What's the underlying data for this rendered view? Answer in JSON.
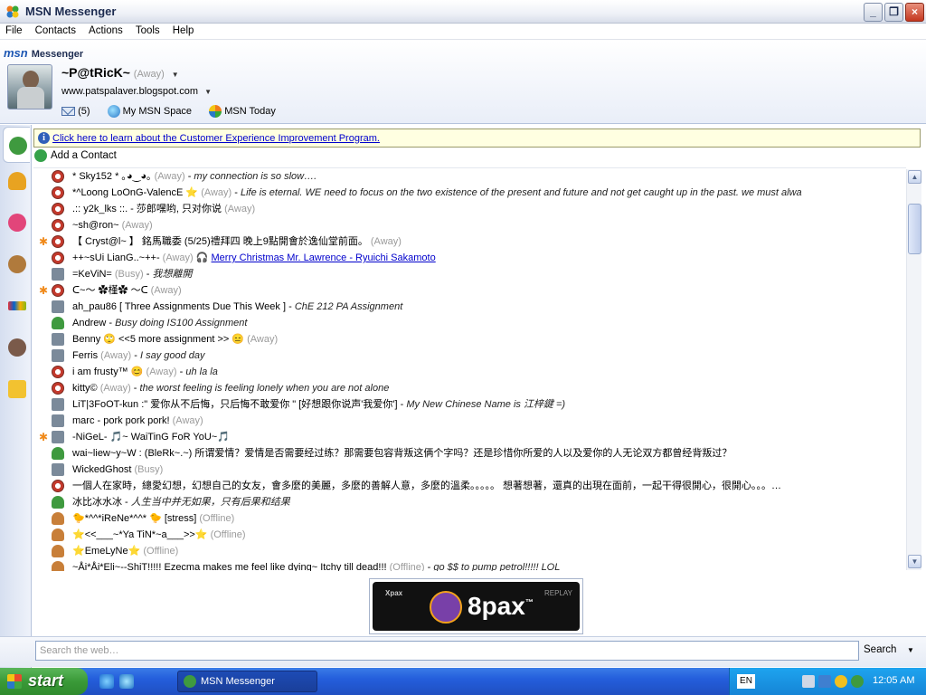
{
  "window": {
    "title": "MSN Messenger",
    "controls": [
      "_",
      "❐",
      "×"
    ]
  },
  "menu": [
    "File",
    "Contacts",
    "Actions",
    "Tools",
    "Help"
  ],
  "header": {
    "logo": "msn",
    "logo_sub": "Messenger",
    "username": "~P@tRicK~",
    "status": "(Away)",
    "personal_message": "www.patspalaver.blogspot.com",
    "mail_count": "(5)",
    "space_link": "My MSN Space",
    "today_link": "MSN Today"
  },
  "infobar": {
    "text": "Click here to learn about the Customer Experience Improvement Program."
  },
  "add_contact": "Add a Contact",
  "contacts": [
    {
      "star": false,
      "icon": "away",
      "name": "* Sky152 * ｡◕‿◕｡ ",
      "status": "(Away)",
      "sep": " - ",
      "message": "my connection is so slow….",
      "link": ""
    },
    {
      "star": false,
      "icon": "away",
      "name": "*^Loong LoOnG-ValencE ⭐ ",
      "status": "(Away)",
      "sep": " - ",
      "message": "Life is eternal. WE need to focus on the two existence of the present and future and not get caught  up in the past. we must alwa",
      "link": ""
    },
    {
      "star": false,
      "icon": "away",
      "name": ".:: y2k_lks ::. - 莎郎嘿哟, 只对你说 ",
      "status": "(Away)",
      "sep": "",
      "message": "",
      "link": ""
    },
    {
      "star": false,
      "icon": "away",
      "name": "~sh@ron~ ",
      "status": "(Away)",
      "sep": "",
      "message": "",
      "link": ""
    },
    {
      "star": true,
      "icon": "away",
      "name": "【 Cryst@l~ 】 銘馬職委 (5/25)禮拜四  晚上9點開會於逸仙堂前面。 ",
      "status": "(Away)",
      "sep": "",
      "message": "",
      "link": ""
    },
    {
      "star": false,
      "icon": "away",
      "name": "++~sUi LianG..~++- ",
      "status": "(Away)",
      "sep": " 🎧 ",
      "message": "",
      "link": "Merry Christmas Mr. Lawrence - Ryuichi Sakamoto"
    },
    {
      "star": false,
      "icon": "busy",
      "name": "=KeViN= ",
      "status": "(Busy)",
      "sep": " - ",
      "message": "我想離開",
      "link": ""
    },
    {
      "star": true,
      "icon": "away",
      "name": "ᑕ~〜    ✿槿✿    〜ᑕ ",
      "status": "(Away)",
      "sep": "",
      "message": "",
      "link": ""
    },
    {
      "star": false,
      "icon": "busy",
      "name": "ah_pau86 [ Three Assignments Due This Week ]",
      "status": "",
      "sep": " - ",
      "message": "ChE 212 PA Assignment",
      "link": ""
    },
    {
      "star": false,
      "icon": "online",
      "name": "Andrew",
      "status": "",
      "sep": " - ",
      "message": "Busy doing IS100 Assignment",
      "link": ""
    },
    {
      "star": false,
      "icon": "busy",
      "name": "Benny 🙄 <<5 more assignment >> 😑 ",
      "status": "(Away)",
      "sep": "",
      "message": "",
      "link": ""
    },
    {
      "star": false,
      "icon": "busy",
      "name": "Ferris ",
      "status": "(Away)",
      "sep": " - ",
      "message": "I say good day",
      "link": ""
    },
    {
      "star": false,
      "icon": "away",
      "name": "i am frusty™ 😊 ",
      "status": "(Away)",
      "sep": " - ",
      "message": "uh la la",
      "link": ""
    },
    {
      "star": false,
      "icon": "away",
      "name": "kitty© ",
      "status": "(Away)",
      "sep": " - ",
      "message": "the worst feeling is feeling lonely when you are not alone",
      "link": ""
    },
    {
      "star": false,
      "icon": "busy",
      "name": "LiT|3FoOT-kun :\" 爱你从不后悔，只后悔不敢爱你 \" [好想跟你说声'我爱你']",
      "status": "",
      "sep": " - ",
      "message": "My New Chinese Name is 江梓鍵 =)",
      "link": ""
    },
    {
      "star": false,
      "icon": "busy",
      "name": "marc - pork pork pork! ",
      "status": "(Away)",
      "sep": "",
      "message": "",
      "link": ""
    },
    {
      "star": true,
      "icon": "busy",
      "name": "-NiGeL- 🎵~ WaiTinG FoR YoU~🎵",
      "status": "",
      "sep": "",
      "message": "",
      "link": ""
    },
    {
      "star": false,
      "icon": "online",
      "name": "wai~liew~y~W : (BleRk~.~) 所谓爱情？爱情是否需要经过练？那需要包容背叛这俩个字吗？还是珍惜你所爱的人以及爱你的人无论双方都曾经背叛过？",
      "status": "",
      "sep": "",
      "message": "",
      "link": ""
    },
    {
      "star": false,
      "icon": "busy",
      "name": "WickedGhost ",
      "status": "(Busy)",
      "sep": "",
      "message": "",
      "link": ""
    },
    {
      "star": false,
      "icon": "away",
      "name": "一個人在家時，總愛幻想，幻想自己的女友，會多麼的美麗，多麼的善解人意，多麼的溫柔。。。。。  想著想著，還真的出現在面前，一起干得很開心，很開心。。。…",
      "status": "",
      "sep": "",
      "message": "",
      "link": ""
    },
    {
      "star": false,
      "icon": "online",
      "name": "冰比冰水冰",
      "status": "",
      "sep": " - ",
      "message": "人生当中并无如果，只有后果和结果",
      "link": ""
    },
    {
      "star": false,
      "icon": "offline",
      "name": "🐤*^^*iReNe*^^* 🐤 [stress] ",
      "status": "(Offline)",
      "sep": "",
      "message": "",
      "link": ""
    },
    {
      "star": false,
      "icon": "offline",
      "name": "⭐<<___~*Ya TiN*~a___>>⭐ ",
      "status": "(Offline)",
      "sep": "",
      "message": "",
      "link": ""
    },
    {
      "star": false,
      "icon": "offline",
      "name": "⭐EmeLyNe⭐ ",
      "status": "(Offline)",
      "sep": "",
      "message": "",
      "link": ""
    },
    {
      "star": false,
      "icon": "offline",
      "name": "~Åi*Åi*Elі~--ShiT!!!!! Ezecma makes me feel like dying~ Itchy till dead!!! ",
      "status": "(Offline)",
      "sep": " - ",
      "message": "go $$ to pump petrol!!!!! LOL",
      "link": ""
    }
  ],
  "ad": {
    "small": "Xpax",
    "brand": "8pax",
    "tm": "™",
    "replay": "REPLAY"
  },
  "search": {
    "placeholder": "Search the web…",
    "button": "Search"
  },
  "taskbar": {
    "start": "start",
    "task_label": "MSN Messenger",
    "lang": "EN",
    "clock": "12:05 AM"
  }
}
